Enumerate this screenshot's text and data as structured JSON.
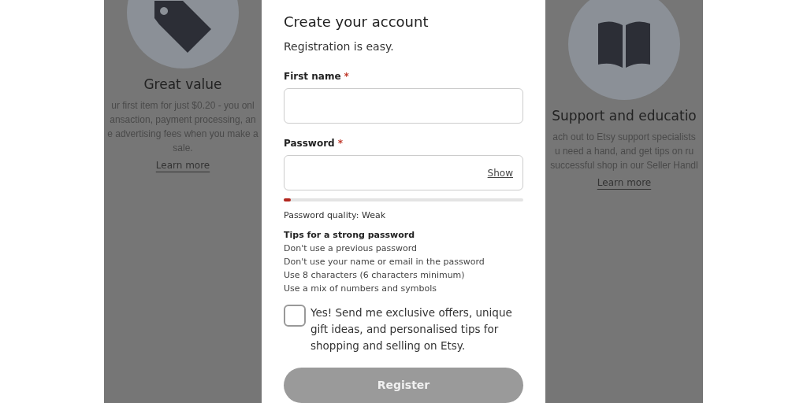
{
  "background_cards": [
    {
      "kind": "tag",
      "title": "Great value",
      "lines": [
        "ur first item for just $0.20 - you onl",
        "ansaction, payment processing, an",
        "e advertising fees when you make a",
        "sale."
      ],
      "link": "Learn more"
    },
    {
      "kind": "book",
      "title": "Support and educatio",
      "lines": [
        "ach out to Etsy support specialists",
        "u need a hand, and get tips on ru",
        "successful shop in our Seller Handl"
      ],
      "link": "Learn more"
    }
  ],
  "dialog": {
    "title": "Create your account",
    "subtitle": "Registration is easy.",
    "fields": [
      {
        "label": "First name",
        "required_mark": "*"
      },
      {
        "label": "Password",
        "required_mark": "*",
        "toggle": "Show"
      }
    ],
    "strength": {
      "level": 0.03,
      "reading": "Password quality: Weak"
    },
    "tips_title": "Tips for a strong password",
    "tips": [
      "Don't use a previous password",
      "Don't use your name or email in the password",
      "Use 8 characters (6 characters minimum)",
      "Use a mix of numbers and symbols"
    ],
    "newsletter": {
      "checked": false,
      "label": "Yes! Send me exclusive offers, unique gift ideas, and personalised tips for shopping and selling on Etsy."
    },
    "submit": {
      "label": "Register",
      "disabled": true
    }
  }
}
